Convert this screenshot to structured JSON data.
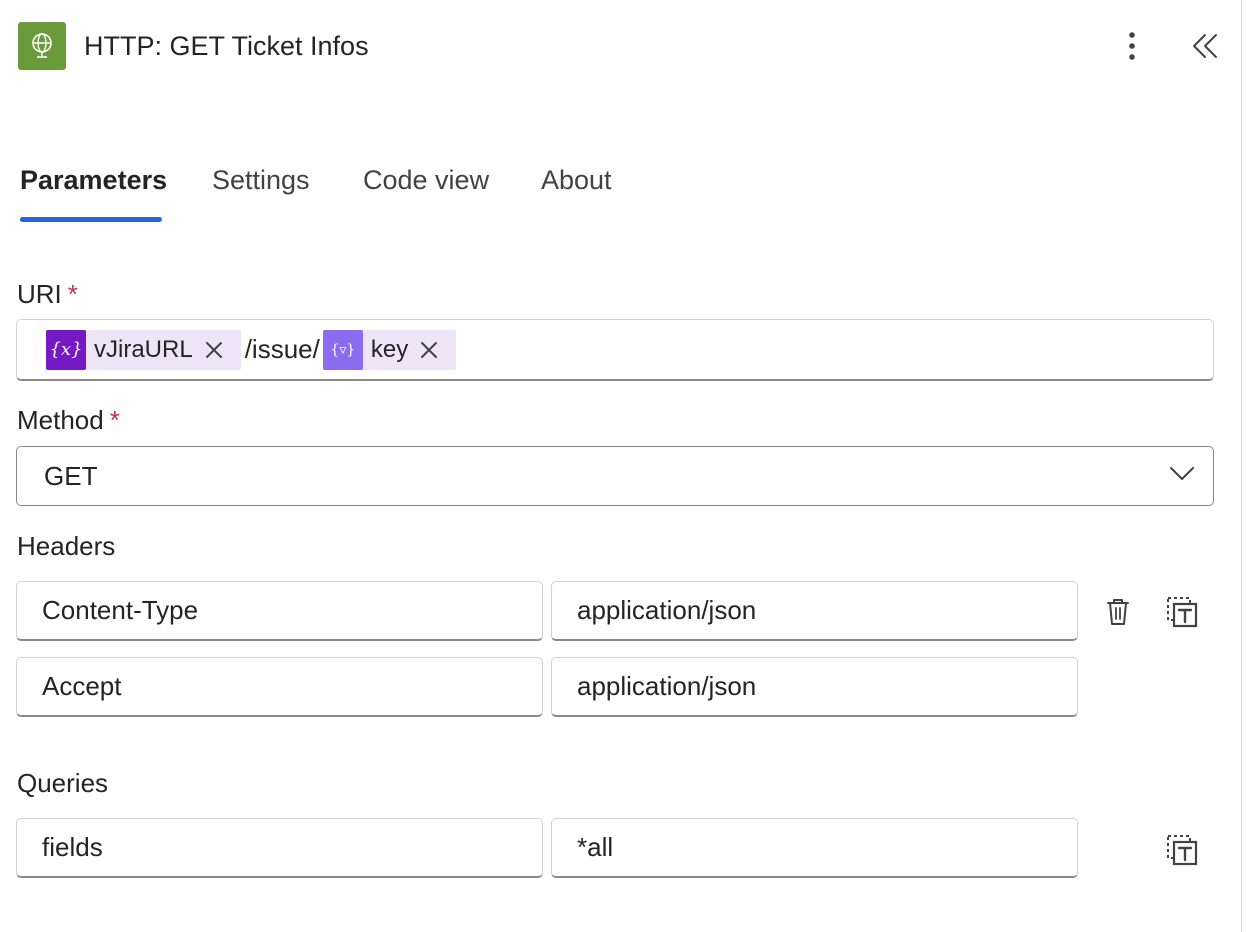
{
  "header": {
    "title": "HTTP: GET Ticket Infos",
    "app_icon": "globe-icon",
    "more_icon": "more-vertical-icon",
    "collapse_icon": "double-chevron-left-icon",
    "accent": "#6b9a3a"
  },
  "tabs": [
    {
      "label": "Parameters",
      "active": true
    },
    {
      "label": "Settings",
      "active": false
    },
    {
      "label": "Code view",
      "active": false
    },
    {
      "label": "About",
      "active": false
    }
  ],
  "uri": {
    "label": "URI",
    "required_mark": "*",
    "tokens": [
      {
        "icon": "variable-icon",
        "icon_text": "{x}",
        "text": "vJiraURL"
      },
      {
        "icon": "parameter-icon",
        "icon_text": "{▿}",
        "text": "key"
      }
    ],
    "separator_text": "/issue/"
  },
  "method": {
    "label": "Method",
    "required_mark": "*",
    "value": "GET"
  },
  "headers": {
    "label": "Headers",
    "rows": [
      {
        "key": "Content-Type",
        "value": "application/json"
      },
      {
        "key": "Accept",
        "value": "application/json"
      }
    ]
  },
  "queries": {
    "label": "Queries",
    "rows": [
      {
        "key": "fields",
        "value": "*all"
      }
    ]
  },
  "colors": {
    "tab_underline": "#2266e3",
    "required": "#c4314b",
    "variable_token": "#7519c4",
    "parameter_token": "#8b6cf0",
    "token_background": "#ede4f8"
  }
}
